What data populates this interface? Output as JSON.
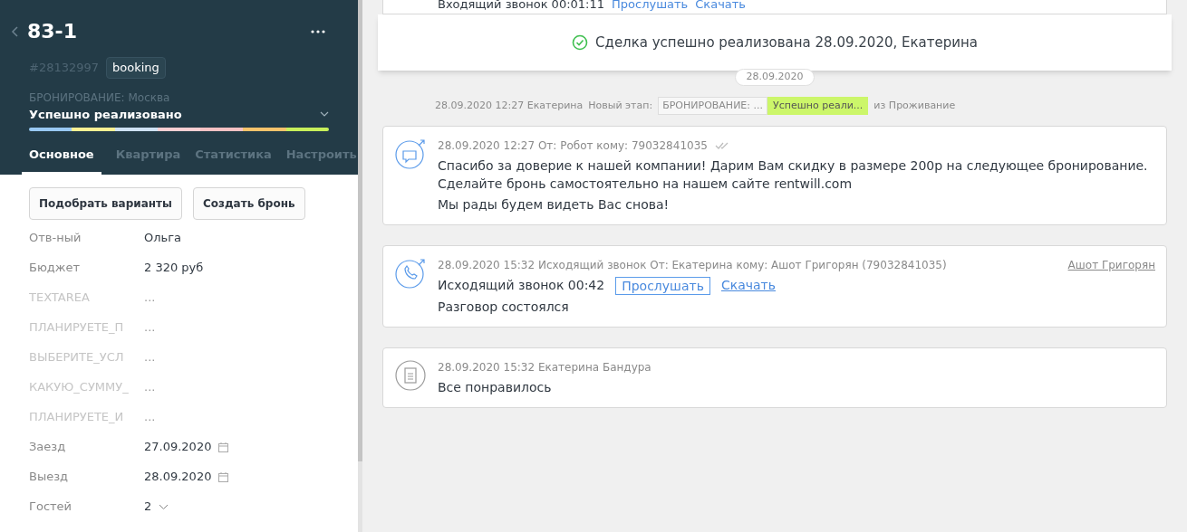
{
  "header": {
    "title": "83-1",
    "id": "#28132997",
    "tag": "booking",
    "pipeline": "БРОНИРОВАНИЕ: Москва",
    "status": "Успешно реализовано",
    "stages": [
      {
        "color": "#99c9f3"
      },
      {
        "color": "#fcf093"
      },
      {
        "color": "#cfe2f5"
      },
      {
        "color": "#fccfd3"
      },
      {
        "color": "#f7c1c4"
      },
      {
        "color": "#f9c36b"
      },
      {
        "color": "#c7ef5a"
      }
    ]
  },
  "tabs": [
    {
      "label": "Основное",
      "selected": true
    },
    {
      "label": "Квартира",
      "selected": false
    },
    {
      "label": "Статистика",
      "selected": false
    },
    {
      "label": "Настроить",
      "selected": false
    }
  ],
  "actions": [
    "Подобрать варианты",
    "Создать бронь"
  ],
  "fields": [
    {
      "label": "Отв-ный",
      "value": "Ольга",
      "kind": "text",
      "empty": false
    },
    {
      "label": "Бюджет",
      "value": "2 320 руб",
      "kind": "text",
      "empty": false
    },
    {
      "label": "TEXTAREA",
      "value": "...",
      "kind": "text",
      "empty": true
    },
    {
      "label": "ПЛАНИРУЕТЕ_П",
      "value": "...",
      "kind": "text",
      "empty": true
    },
    {
      "label": "ВЫБЕРИТЕ_УСЛ",
      "value": "...",
      "kind": "text",
      "empty": true
    },
    {
      "label": "КАКУЮ_СУММУ_",
      "value": "...",
      "kind": "text",
      "empty": true
    },
    {
      "label": "ПЛАНИРУЕТЕ_И",
      "value": "...",
      "kind": "text",
      "empty": true
    },
    {
      "label": "Заезд",
      "value": "27.09.2020",
      "kind": "date",
      "empty": false
    },
    {
      "label": "Выезд",
      "value": "28.09.2020",
      "kind": "date",
      "empty": false
    },
    {
      "label": "Гостей",
      "value": "2",
      "kind": "select",
      "empty": false
    }
  ],
  "feed": {
    "previous": {
      "text": "Входящий звонок 00:01:11",
      "listen": "Прослушать",
      "download": "Скачать"
    },
    "notification": "Сделка успешно реализована 28.09.2020, Екатерина",
    "date_pill": "28.09.2020",
    "stage_change": {
      "meta": "28.09.2020 12:27 Екатерина",
      "label": "Новый этап:",
      "from_stage": "БРОНИРОВАНИЕ: ...",
      "to_stage": "Успешно реали...",
      "suffix": "из Проживание"
    },
    "entries": [
      {
        "kind": "sms",
        "meta": "28.09.2020 12:27 От: Робот кому: 79032841035",
        "lines": [
          "Спасибо за доверие к нашей компании! Дарим Вам скидку в размере 200р на следующее бронирование. Сделайте бронь самостоятельно на нашем сайте rentwill.com",
          "Мы рады будем видеть Вас снова!"
        ]
      },
      {
        "kind": "call",
        "meta": "28.09.2020 15:32 Исходящий звонок От: Екатерина кому: Ашот Григорян (79032841035)",
        "contact": "Ашот Григорян",
        "call": "Исходящий звонок 00:42",
        "listen": "Прослушать",
        "download": "Скачать",
        "lines": [
          "Разговор состоялся"
        ]
      },
      {
        "kind": "note",
        "meta": "28.09.2020 15:32 Екатерина Бандура",
        "lines": [
          "Все понравилось"
        ]
      }
    ]
  }
}
